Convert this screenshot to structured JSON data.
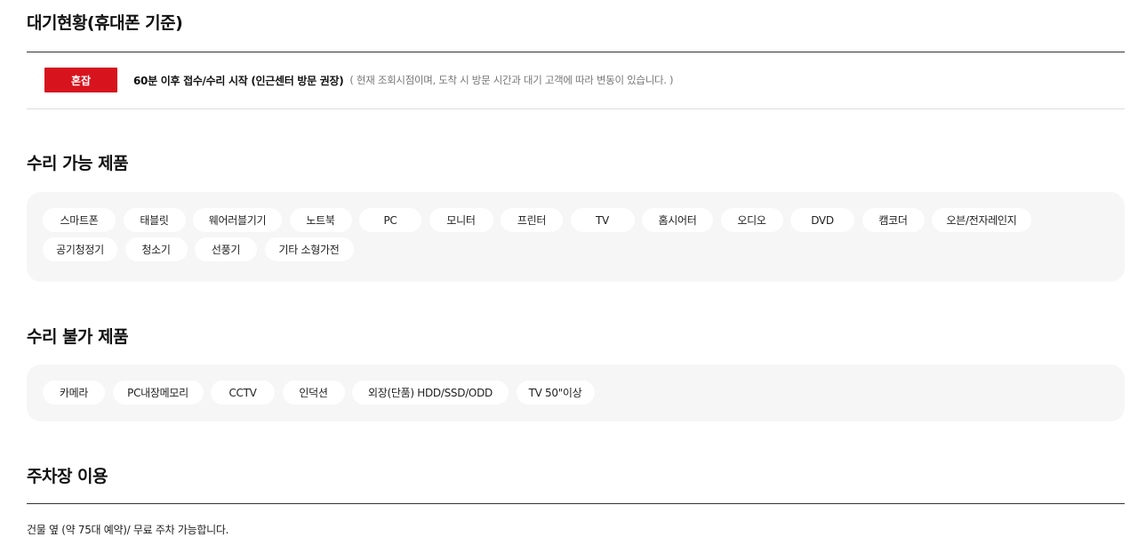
{
  "wait_status": {
    "title": "대기현황(휴대폰 기준)",
    "badge": "혼잡",
    "main_text": "60분 이후 접수/수리 시작 (인근센터 방문 권장)",
    "note": "( 현재 조회시점이며, 도착 시 방문 시간과 대기 고객에 따라 변동이 있습니다. )",
    "badge_color": "#d7141e"
  },
  "repair_possible": {
    "title": "수리 가능 제품",
    "items": [
      "스마트폰",
      "태블릿",
      "웨어러블기기",
      "노트북",
      "PC",
      "모니터",
      "프린터",
      "TV",
      "홈시어터",
      "오디오",
      "DVD",
      "캠코더",
      "오븐/전자레인지",
      "공기청정기",
      "청소기",
      "선풍기",
      "기타 소형가전"
    ]
  },
  "repair_impossible": {
    "title": "수리 불가 제품",
    "items": [
      "카메라",
      "PC내장메모리",
      "CCTV",
      "인덕션",
      "외장(단품) HDD/SSD/ODD",
      "TV 50\"이상"
    ]
  },
  "parking": {
    "title": "주차장 이용",
    "text": "건물 옆 (약 75대 예약)/ 무료 주차 가능합니다."
  }
}
